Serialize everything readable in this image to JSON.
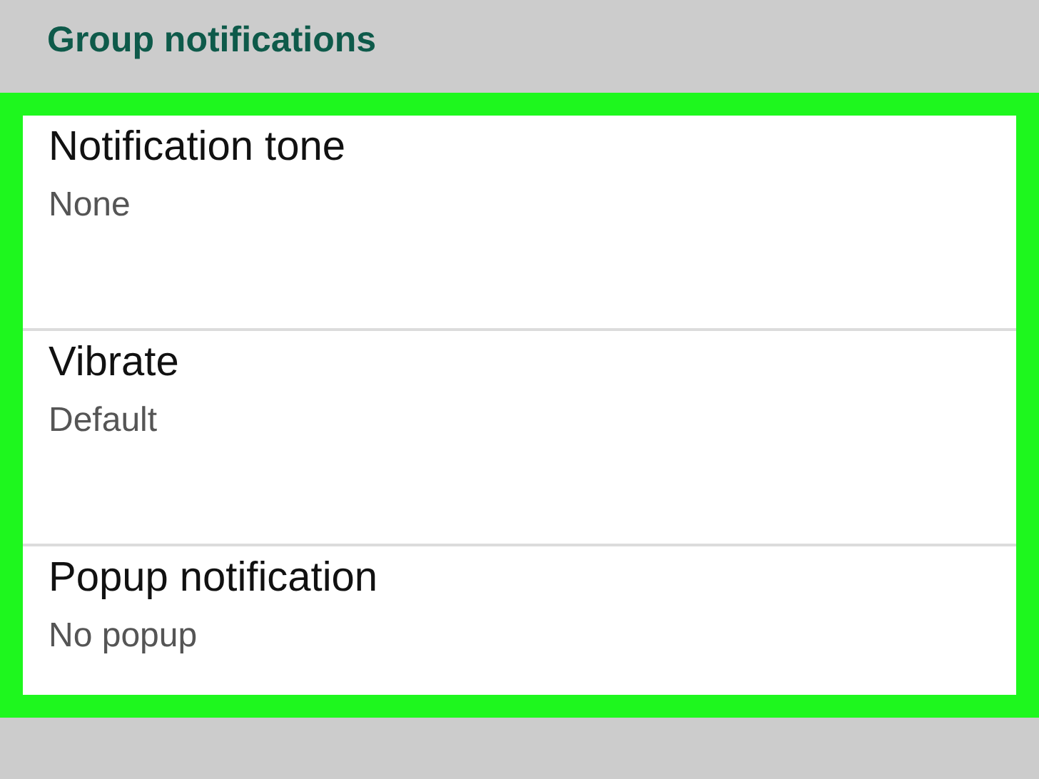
{
  "section_header": {
    "title": "Group notifications"
  },
  "highlighted_settings": [
    {
      "title": "Notification tone",
      "value": "None"
    },
    {
      "title": "Vibrate",
      "value": "Default"
    },
    {
      "title": "Popup notification",
      "value": "No popup"
    }
  ]
}
